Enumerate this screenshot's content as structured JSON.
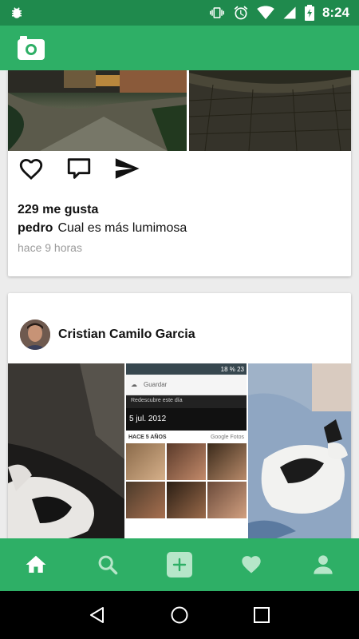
{
  "status_bar": {
    "time": "8:24",
    "battery_icon": "battery-charging-icon",
    "icons": [
      "debug-icon",
      "vibrate-icon",
      "alarm-icon",
      "wifi-icon",
      "signal-icon",
      "battery-charging-icon"
    ]
  },
  "app_bar": {
    "icon": "camera-icon"
  },
  "posts": [
    {
      "likes": "229 me gusta",
      "username": "pedro",
      "caption": "Cual es más lumimosa",
      "time_ago": "hace 9 horas"
    },
    {
      "author": "Cristian Camilo Garcia",
      "embedded_screenshot": {
        "status": "18 % 23",
        "search_label": "Guardar",
        "banner": "Redescubre este día",
        "date": "5 jul. 2012",
        "section_label": "HACE 5 AÑOS",
        "source_label": "Google Fotos"
      }
    }
  ],
  "bottom_nav": [
    "home-icon",
    "search-icon",
    "add-icon",
    "heart-icon",
    "profile-icon"
  ],
  "colors": {
    "accent": "#2eaf66",
    "status_bar": "#1f8a4d"
  }
}
